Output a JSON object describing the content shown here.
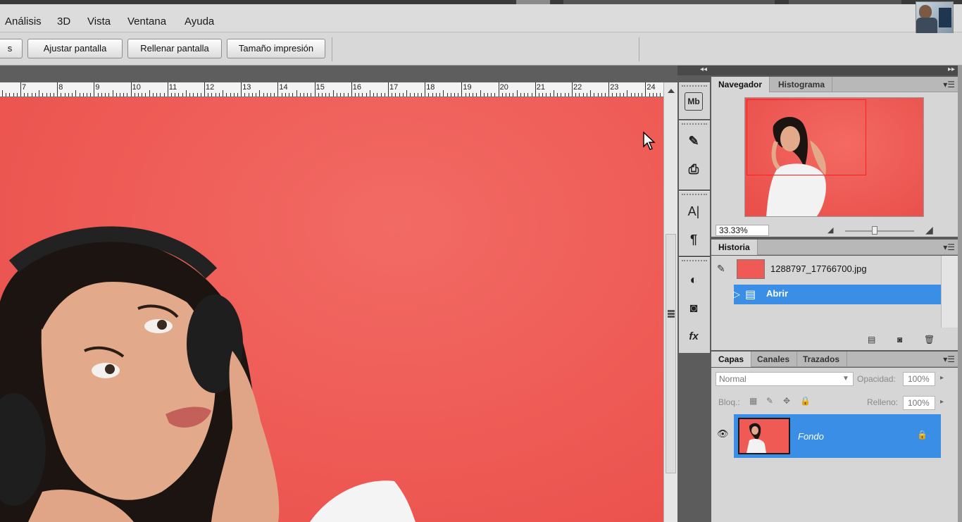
{
  "menu": [
    "Análisis",
    "3D",
    "Vista",
    "Ventana",
    "Ayuda"
  ],
  "options_bar": {
    "left_partial": "s",
    "buttons": [
      "Ajustar pantalla",
      "Rellenar pantalla",
      "Tamaño impresión"
    ]
  },
  "ruler": {
    "labels": [
      "7",
      "8",
      "9",
      "10",
      "11",
      "12",
      "13",
      "14",
      "15",
      "16",
      "17",
      "18",
      "19",
      "20",
      "21",
      "22",
      "23",
      "24"
    ]
  },
  "colors": {
    "canvas_red": "#ee5954",
    "selection_blue": "#3a8ee6",
    "panel_bg": "#d6d6d6",
    "dark_bg": "#5c5c5c"
  },
  "tools": {
    "items": [
      {
        "icon": "mini-bridge-icon",
        "glyph": "Mb"
      },
      {
        "icon": "brush-presets-icon",
        "glyph": "✎"
      },
      {
        "icon": "clone-source-icon",
        "glyph": "⎙"
      },
      {
        "icon": "character-icon",
        "glyph": "A|"
      },
      {
        "icon": "paragraph-icon",
        "glyph": "¶"
      },
      {
        "icon": "adjustments-icon",
        "glyph": "◐"
      },
      {
        "icon": "masks-icon",
        "glyph": "◙"
      },
      {
        "icon": "styles-fx-icon",
        "glyph": "fx"
      }
    ]
  },
  "navigator": {
    "tabs": [
      "Navegador",
      "Histograma"
    ],
    "zoom": "33.33%"
  },
  "history": {
    "tab": "Historia",
    "rows": [
      {
        "name": "1288797_17766700.jpg",
        "selected": false
      },
      {
        "name": "Abrir",
        "selected": true
      }
    ]
  },
  "layers": {
    "tabs": [
      "Capas",
      "Canales",
      "Trazados"
    ],
    "blend_mode": "Normal",
    "opacity_label": "Opacidad:",
    "opacity_value": "100%",
    "lock_label": "Bloq.:",
    "fill_label": "Relleno:",
    "fill_value": "100%",
    "layer_name": "Fondo"
  },
  "dock": {
    "collapse_left": "◂◂",
    "collapse_right": "▸▸"
  }
}
